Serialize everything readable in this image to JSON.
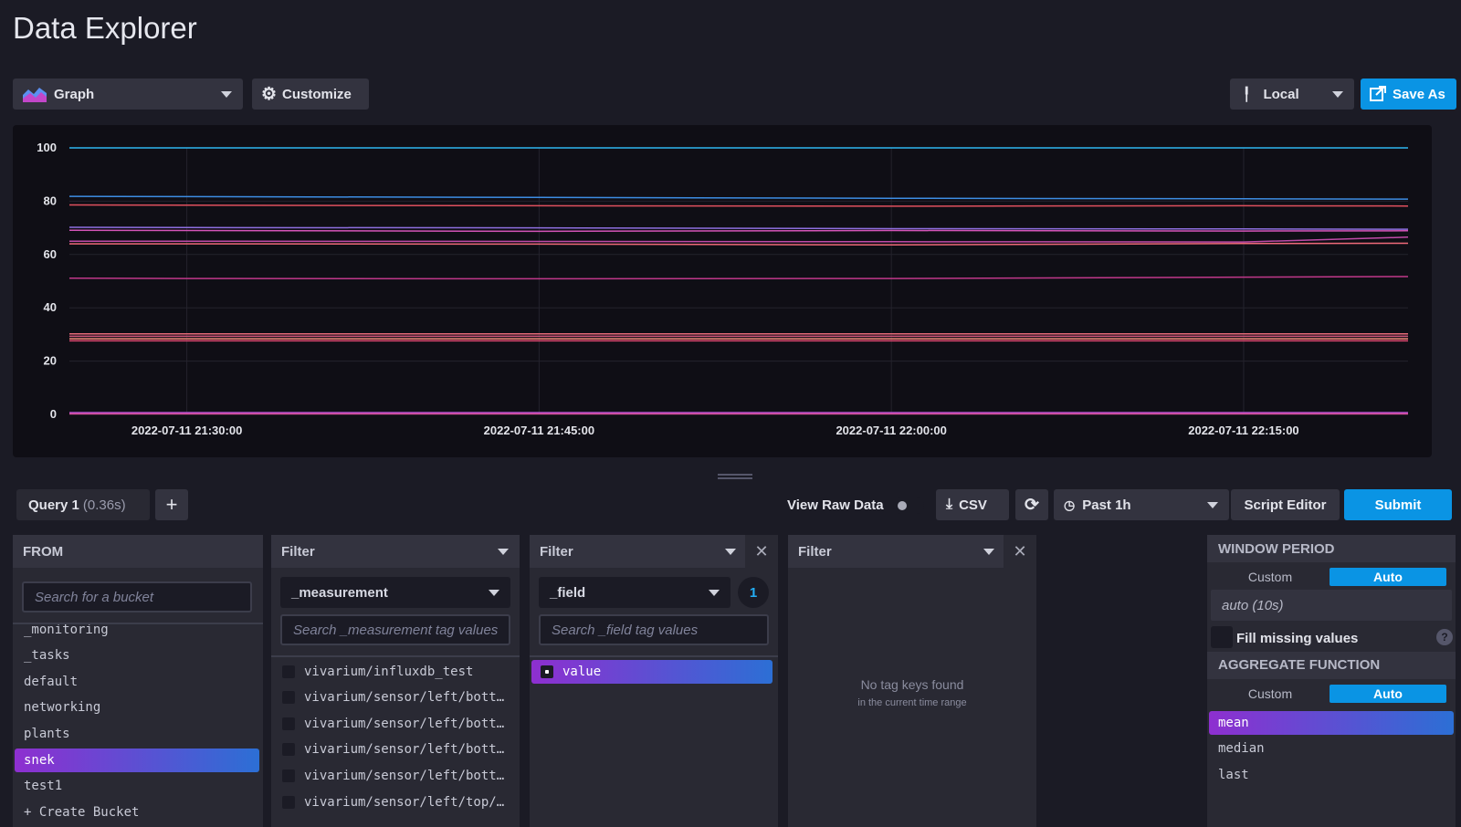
{
  "page": {
    "title": "Data Explorer"
  },
  "toolbar": {
    "view_type": "Graph",
    "customize_label": "Customize",
    "timezone": "Local",
    "save_as_label": "Save As"
  },
  "chart_data": {
    "type": "line",
    "title": "",
    "xlabel": "",
    "ylabel": "",
    "ylim": [
      0,
      100
    ],
    "yticks": [
      "100",
      "80",
      "60",
      "40",
      "20",
      "0"
    ],
    "xticks": [
      "2022-07-11 21:30:00",
      "2022-07-11 21:45:00",
      "2022-07-11 22:00:00",
      "2022-07-11 22:15:00"
    ],
    "x": [
      "2022-07-11 21:25:00",
      "2022-07-11 21:30:00",
      "2022-07-11 21:45:00",
      "2022-07-11 22:00:00",
      "2022-07-11 22:15:00",
      "2022-07-11 22:22:00"
    ],
    "grid": true,
    "series": [
      {
        "values": [
          100,
          100,
          100,
          100,
          100,
          100
        ],
        "color": "#2fb6f0"
      },
      {
        "values": [
          81.8,
          81.7,
          81.4,
          81.1,
          80.9,
          80.8
        ],
        "color": "#3d8de3"
      },
      {
        "values": [
          78.6,
          78.5,
          78.3,
          78.1,
          78.3,
          78.2
        ],
        "color": "#e0505e"
      },
      {
        "values": [
          70.2,
          70.1,
          70.0,
          69.7,
          69.6,
          69.5
        ],
        "color": "#8e6fe0"
      },
      {
        "values": [
          69.1,
          69.0,
          68.7,
          69.0,
          68.8,
          68.9
        ],
        "color": "#d454b8"
      },
      {
        "values": [
          65.0,
          65.0,
          64.9,
          64.8,
          64.7,
          66.5
        ],
        "color": "#c04aa8"
      },
      {
        "values": [
          64.0,
          64.0,
          63.9,
          63.6,
          64.1,
          64.2
        ],
        "color": "#f06a7a"
      },
      {
        "values": [
          51.1,
          51.0,
          50.9,
          51.0,
          51.5,
          51.7
        ],
        "color": "#c0388a"
      },
      {
        "values": [
          30.2,
          30.2,
          30.2,
          30.2,
          30.2,
          30.2
        ],
        "color": "#e86a78"
      },
      {
        "values": [
          29.3,
          29.3,
          29.3,
          29.3,
          29.3,
          29.3
        ],
        "color": "#d0567a"
      },
      {
        "values": [
          28.4,
          28.4,
          28.4,
          28.4,
          28.4,
          28.4
        ],
        "color": "#f08a7a"
      },
      {
        "values": [
          27.6,
          27.6,
          27.6,
          27.6,
          27.6,
          27.6
        ],
        "color": "#e04a70"
      },
      {
        "values": [
          0.7,
          0.7,
          0.7,
          0.7,
          0.7,
          0.7
        ],
        "color": "#b050d0"
      },
      {
        "values": [
          0.2,
          0.2,
          0.2,
          0.2,
          0.2,
          0.2
        ],
        "color": "#e050a0"
      }
    ]
  },
  "query_bar": {
    "query_tab": "Query 1",
    "query_time": "(0.36s)",
    "add_label": "+",
    "raw_data_label": "View Raw Data",
    "csv_label": "CSV",
    "time_range": "Past 1h",
    "script_editor_label": "Script Editor",
    "submit_label": "Submit"
  },
  "from_panel": {
    "header": "FROM",
    "search_placeholder": "Search for a bucket",
    "buckets": [
      "_monitoring",
      "_tasks",
      "default",
      "networking",
      "plants",
      "snek",
      "test1"
    ],
    "selected_bucket": "snek",
    "create_label": "+ Create Bucket"
  },
  "filter1": {
    "header": "Filter",
    "key": "_measurement",
    "search_placeholder": "Search _measurement tag values",
    "values": [
      "vivarium/influxdb_test",
      "vivarium/sensor/left/bott…",
      "vivarium/sensor/left/bott…",
      "vivarium/sensor/left/bott…",
      "vivarium/sensor/left/bott…",
      "vivarium/sensor/left/top/…"
    ]
  },
  "filter2": {
    "header": "Filter",
    "key": "_field",
    "count": "1",
    "search_placeholder": "Search _field tag values",
    "values": [
      "value"
    ]
  },
  "filter3": {
    "header": "Filter",
    "empty_title": "No tag keys found",
    "empty_sub": "in the current time range"
  },
  "right_panel": {
    "window_period_label": "WINDOW PERIOD",
    "custom_label": "Custom",
    "auto_label": "Auto",
    "window_value": "auto (10s)",
    "fill_missing_label": "Fill missing values",
    "help_label": "?",
    "aggregate_label": "AGGREGATE FUNCTION",
    "agg_custom_label": "Custom",
    "agg_auto_label": "Auto",
    "functions": [
      "mean",
      "median",
      "last"
    ],
    "selected_function": "mean"
  }
}
